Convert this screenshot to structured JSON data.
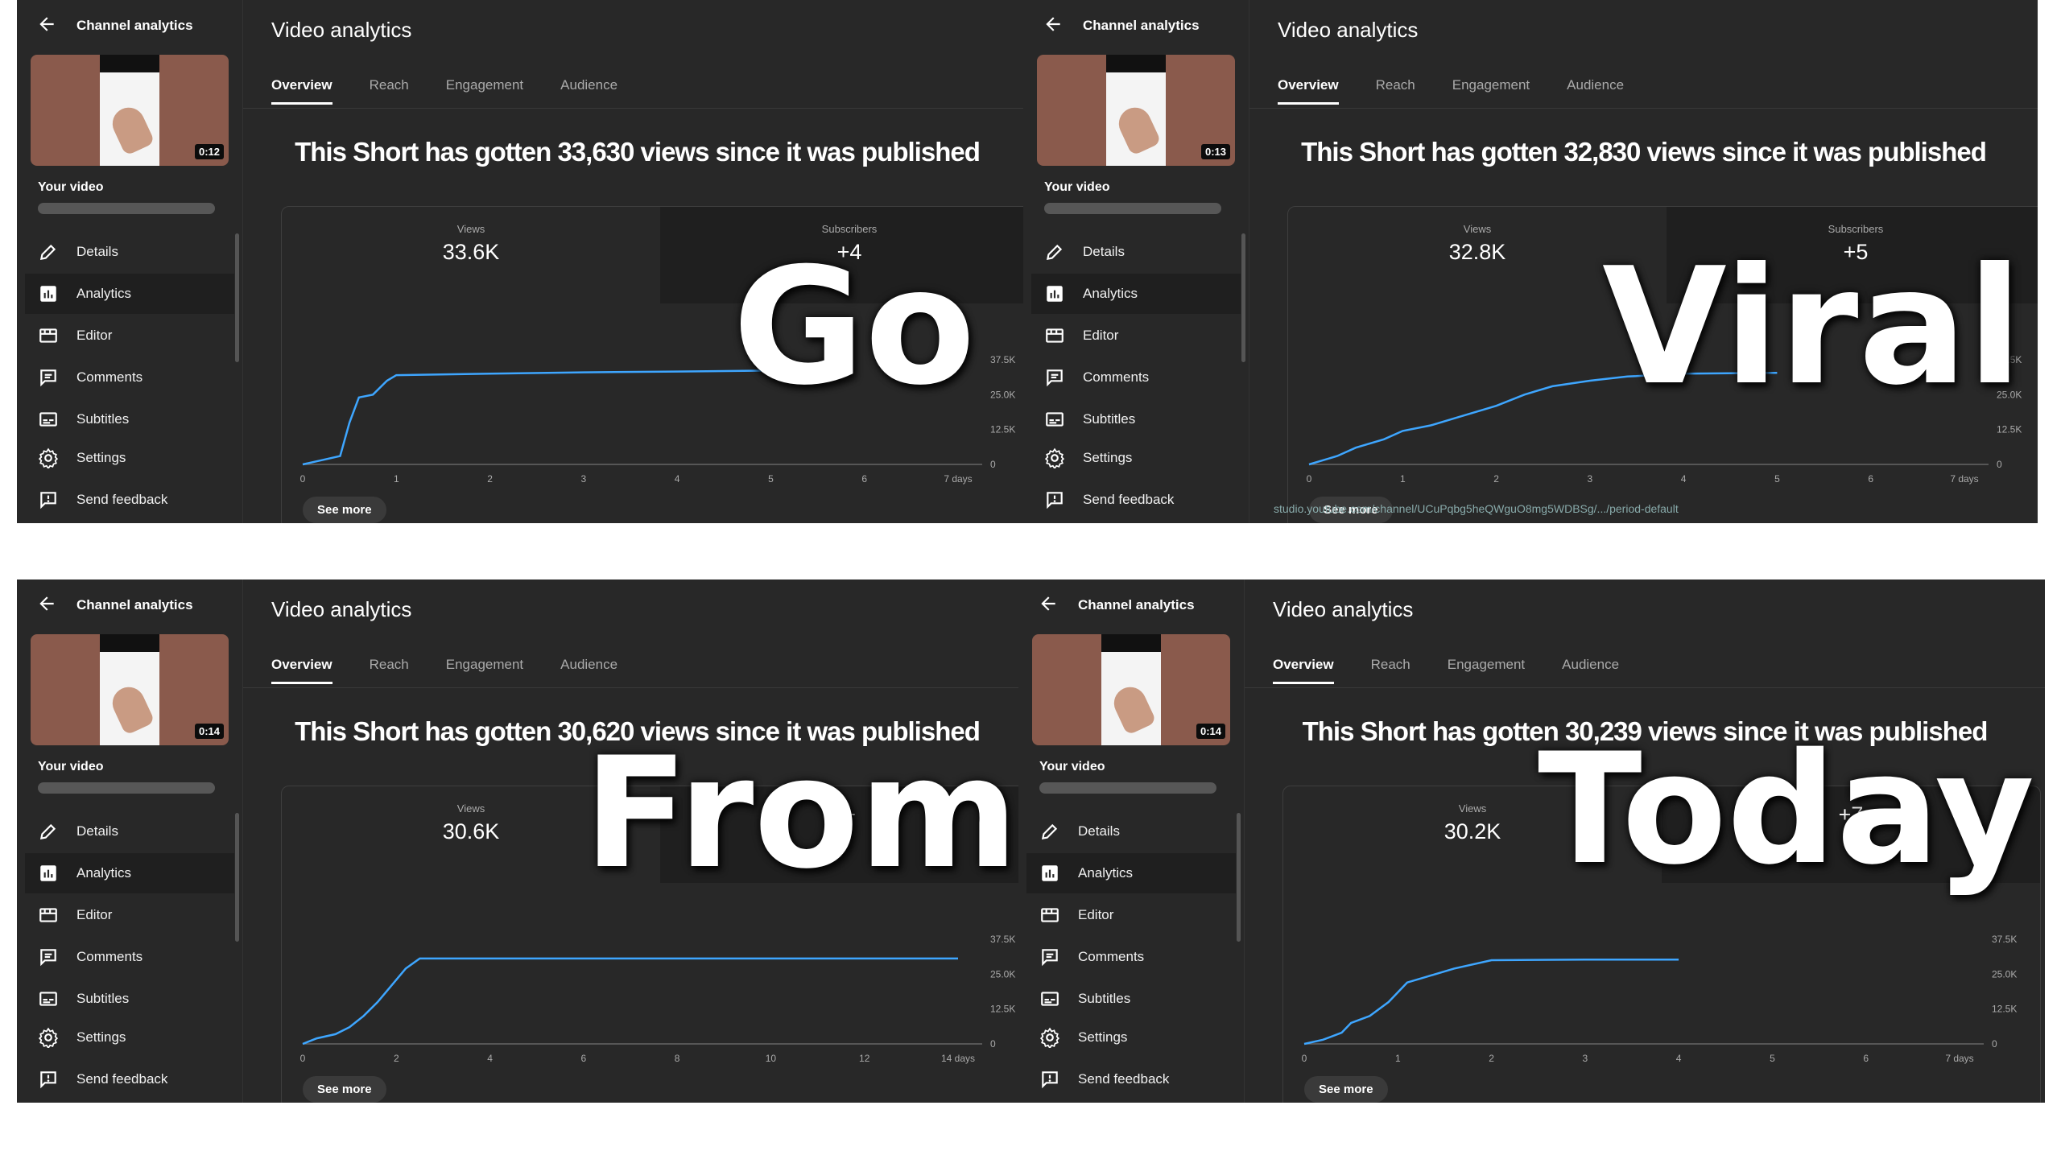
{
  "panels": [
    {
      "sidebar_title": "Channel analytics",
      "duration": "0:12",
      "your_video": "Your video",
      "nav": [
        "Details",
        "Analytics",
        "Editor",
        "Comments",
        "Subtitles",
        "Settings",
        "Send feedback"
      ],
      "main_title": "Video analytics",
      "tabs": [
        "Overview",
        "Reach",
        "Engagement",
        "Audience"
      ],
      "headline": "This Short has gotten 33,630 views since it was published",
      "views_label": "Views",
      "views_value": "33.6K",
      "subs_label": "Subscribers",
      "subs_value": "+4",
      "see_more": "See more",
      "url": "",
      "overlay": "Go"
    },
    {
      "sidebar_title": "Channel analytics",
      "duration": "0:13",
      "your_video": "Your video",
      "nav": [
        "Details",
        "Analytics",
        "Editor",
        "Comments",
        "Subtitles",
        "Settings",
        "Send feedback"
      ],
      "main_title": "Video analytics",
      "tabs": [
        "Overview",
        "Reach",
        "Engagement",
        "Audience"
      ],
      "headline": "This Short has gotten 32,830 views since it was published",
      "views_label": "Views",
      "views_value": "32.8K",
      "subs_label": "Subscribers",
      "subs_value": "+5",
      "see_more": "See more",
      "url": "studio.youtube.com/channel/UCuPqbg5heQWguO8mg5WDBSg/.../period-default",
      "overlay": "Viral"
    },
    {
      "sidebar_title": "Channel analytics",
      "duration": "0:14",
      "your_video": "Your video",
      "nav": [
        "Details",
        "Analytics",
        "Editor",
        "Comments",
        "Subtitles",
        "Settings",
        "Send feedback"
      ],
      "main_title": "Video analytics",
      "tabs": [
        "Overview",
        "Reach",
        "Engagement",
        "Audience"
      ],
      "headline": "This Short has gotten 30,620 views since it was published",
      "views_label": "Views",
      "views_value": "30.6K",
      "subs_label": "",
      "subs_value": "+",
      "see_more": "See more",
      "url": "",
      "overlay": "From"
    },
    {
      "sidebar_title": "Channel analytics",
      "duration": "0:14",
      "your_video": "Your video",
      "nav": [
        "Details",
        "Analytics",
        "Editor",
        "Comments",
        "Subtitles",
        "Settings",
        "Send feedback"
      ],
      "main_title": "Video analytics",
      "tabs": [
        "Overview",
        "Reach",
        "Engagement",
        "Audience"
      ],
      "headline": "This Short has gotten 30,239 views since it was published",
      "views_label": "Views",
      "views_value": "30.2K",
      "subs_label": "",
      "subs_value": "+7",
      "see_more": "See more",
      "url": "",
      "overlay": "Today"
    }
  ],
  "chart_data": [
    {
      "type": "line",
      "x_ticks": [
        "0",
        "1",
        "2",
        "3",
        "4",
        "5",
        "6",
        "7 days"
      ],
      "y_ticks": [
        "37.5K",
        "25.0K",
        "12.5K",
        "0"
      ],
      "ylim": [
        0,
        37500
      ],
      "x": [
        0,
        0.2,
        0.4,
        0.5,
        0.6,
        0.75,
        0.9,
        1,
        2,
        3,
        4,
        5
      ],
      "y": [
        0,
        1500,
        3000,
        15000,
        24000,
        25000,
        30000,
        32000,
        32500,
        33000,
        33300,
        33630
      ]
    },
    {
      "type": "line",
      "x_ticks": [
        "0",
        "1",
        "2",
        "3",
        "4",
        "5",
        "6",
        "7 days"
      ],
      "y_ticks": [
        "37.5K",
        "25.0K",
        "12.5K",
        "0"
      ],
      "ylim": [
        0,
        37500
      ],
      "x": [
        0,
        0.3,
        0.5,
        0.8,
        1,
        1.3,
        1.6,
        2,
        2.3,
        2.6,
        3,
        3.4,
        4,
        5
      ],
      "y": [
        0,
        3000,
        6000,
        9000,
        12000,
        14000,
        17000,
        21000,
        25000,
        28000,
        30000,
        31500,
        32500,
        32830
      ]
    },
    {
      "type": "line",
      "x_ticks": [
        "0",
        "2",
        "4",
        "6",
        "8",
        "10",
        "12",
        "14 days"
      ],
      "y_ticks": [
        "37.5K",
        "25.0K",
        "12.5K",
        "0"
      ],
      "ylim": [
        0,
        37500
      ],
      "x": [
        0,
        0.3,
        0.7,
        1,
        1.3,
        1.6,
        1.9,
        2.2,
        2.5,
        14
      ],
      "y": [
        0,
        2000,
        3500,
        6000,
        10000,
        15000,
        21000,
        27000,
        30620,
        30620
      ]
    },
    {
      "type": "line",
      "x_ticks": [
        "0",
        "1",
        "2",
        "3",
        "4",
        "5",
        "6",
        "7 days"
      ],
      "y_ticks": [
        "37.5K",
        "25.0K",
        "12.5K",
        "0"
      ],
      "ylim": [
        0,
        37500
      ],
      "x": [
        0,
        0.2,
        0.4,
        0.5,
        0.7,
        0.9,
        1.1,
        1.3,
        1.6,
        2,
        3,
        4
      ],
      "y": [
        0,
        1500,
        4000,
        7500,
        10000,
        15000,
        22000,
        24000,
        27000,
        30000,
        30239,
        30239
      ]
    }
  ],
  "colors": {
    "panel_bg": "#282828",
    "line": "#3ea6ff",
    "text": "#f1f1f1"
  }
}
